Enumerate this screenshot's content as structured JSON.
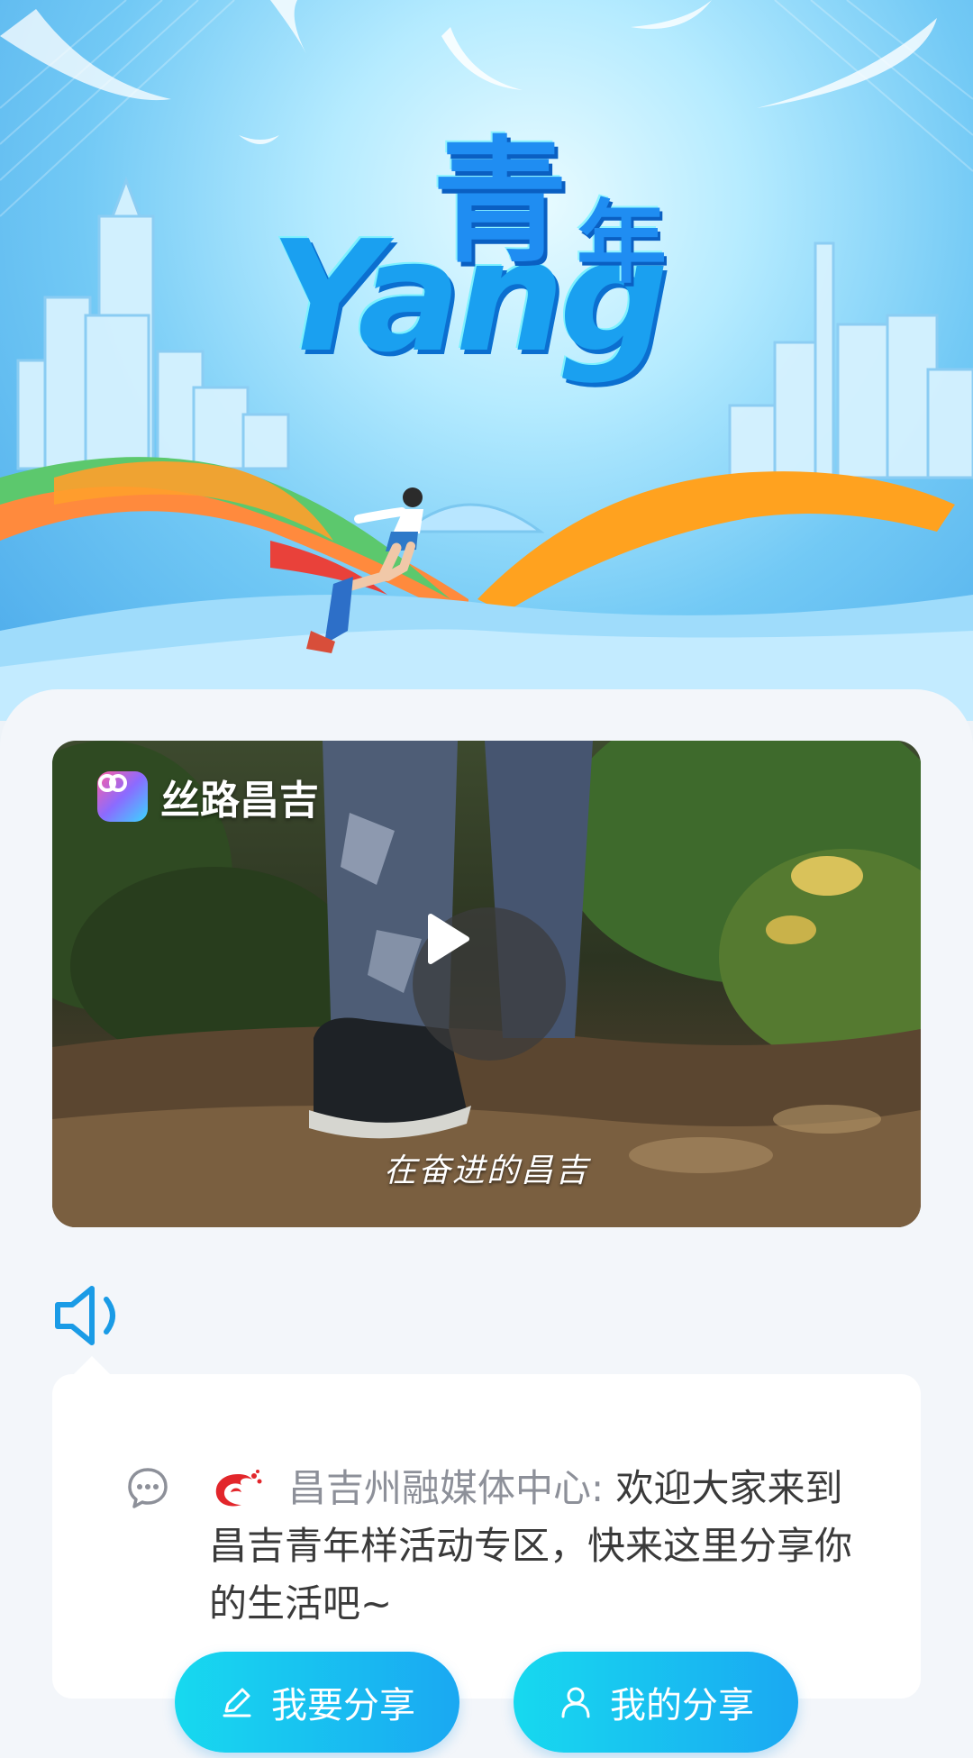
{
  "hero": {
    "title_latin": "Yang",
    "title_cn_main": "青",
    "title_cn_second": "年"
  },
  "video": {
    "brand_name": "丝路昌吉",
    "caption": "在奋进的昌吉",
    "play_icon": "play-icon"
  },
  "audio": {
    "icon": "speaker-icon"
  },
  "notice": {
    "icon": "chat-bubble-icon",
    "org_logo": "org-logo-icon",
    "author": "昌吉州融媒体中心:",
    "message": " 欢迎大家来到昌吉青年样活动专区，快来这里分享你的生活吧~"
  },
  "actions": {
    "share_label": "我要分享",
    "share_icon": "pencil-icon",
    "mine_label": "我的分享",
    "mine_icon": "user-icon"
  },
  "colors": {
    "accent_gradient_start": "#17d9ef",
    "accent_gradient_end": "#1aa8f2",
    "title_blue": "#1f8df2",
    "author_gray": "#8d9099"
  }
}
